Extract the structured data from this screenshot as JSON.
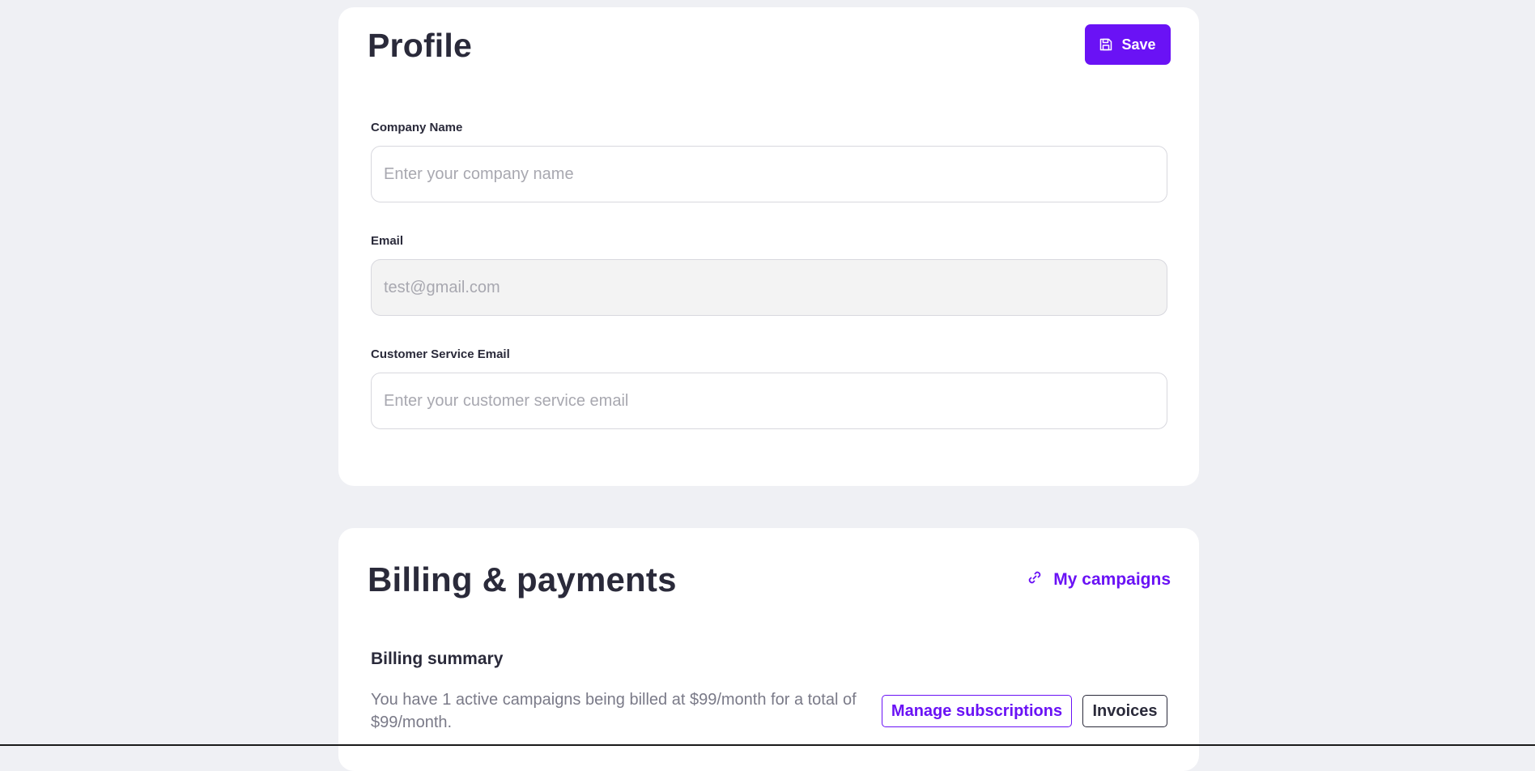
{
  "colors": {
    "accent": "#6a12f5",
    "page_background": "#eff0f4",
    "card_background": "#ffffff",
    "text_primary": "#2a2a3a",
    "text_muted": "#7a7a88"
  },
  "profile": {
    "title": "Profile",
    "save_label": "Save",
    "save_icon": "save-icon",
    "fields": [
      {
        "label": "Company Name",
        "value": "",
        "placeholder": "Enter your company name",
        "disabled": false
      },
      {
        "label": "Email",
        "value": "",
        "placeholder": "test@gmail.com",
        "disabled": true
      },
      {
        "label": "Customer Service Email",
        "value": "",
        "placeholder": "Enter your customer service email",
        "disabled": false
      }
    ]
  },
  "billing": {
    "title": "Billing & payments",
    "campaigns_link_label": "My campaigns",
    "campaigns_link_icon": "link-icon",
    "summary_heading": "Billing summary",
    "summary_text": "You have 1 active campaigns being billed at $99/month for a total of $99/month.",
    "manage_label": "Manage subscriptions",
    "invoices_label": "Invoices"
  }
}
